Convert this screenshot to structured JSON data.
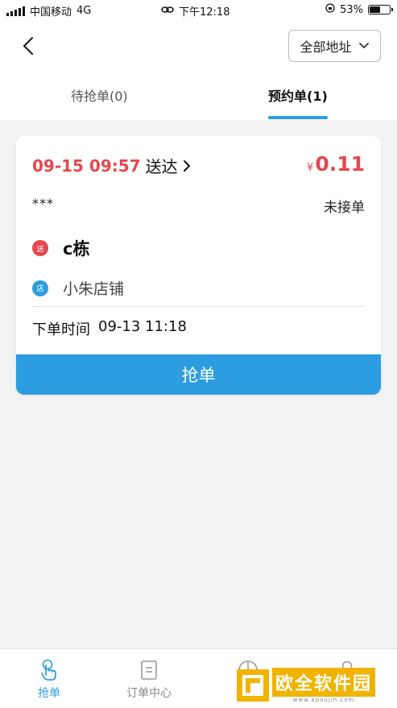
{
  "status_bar": {
    "carrier": "中国移动",
    "network": "4G",
    "time": "下午12:18",
    "battery_percent": "53%",
    "battery_level": 0.53
  },
  "header": {
    "address_filter": "全部地址"
  },
  "tabs": [
    {
      "label": "待抢单(0)",
      "active": false
    },
    {
      "label": "预约单(1)",
      "active": true
    }
  ],
  "order": {
    "delivery_time": "09-15 09:57",
    "delivery_label": "送达",
    "currency": "¥",
    "price": "0.11",
    "customer": "***",
    "status": "未接单",
    "send_badge": "送",
    "destination": "c栋",
    "shop_badge": "店",
    "shop": "小朱店铺",
    "order_time_label": "下单时间",
    "order_time": "09-13 11:18",
    "grab_button": "抢单"
  },
  "bottom_nav": [
    {
      "label": "抢单",
      "icon": "hand-tap-icon",
      "active": true
    },
    {
      "label": "订单中心",
      "icon": "document-icon",
      "active": false
    },
    {
      "label": "",
      "icon": "pie-chart-icon",
      "active": false
    },
    {
      "label": "",
      "icon": "person-icon",
      "active": false
    }
  ],
  "watermark": {
    "text": "欧全软件园",
    "url": "www.apoujih.com"
  },
  "colors": {
    "accent": "#2b9de0",
    "price_red": "#e5484d",
    "watermark_gold": "#f0b400"
  }
}
